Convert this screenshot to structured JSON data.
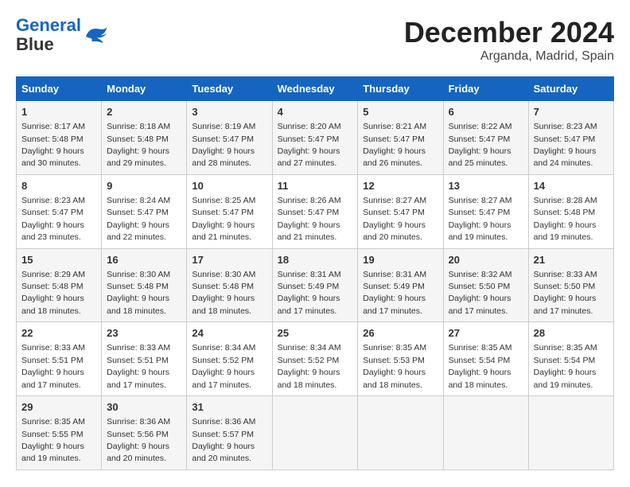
{
  "header": {
    "logo_line1": "General",
    "logo_line2": "Blue",
    "title": "December 2024",
    "subtitle": "Arganda, Madrid, Spain"
  },
  "calendar": {
    "headers": [
      "Sunday",
      "Monday",
      "Tuesday",
      "Wednesday",
      "Thursday",
      "Friday",
      "Saturday"
    ],
    "weeks": [
      [
        {
          "day": "1",
          "sunrise": "8:17 AM",
          "sunset": "5:48 PM",
          "daylight": "9 hours and 30 minutes."
        },
        {
          "day": "2",
          "sunrise": "8:18 AM",
          "sunset": "5:48 PM",
          "daylight": "9 hours and 29 minutes."
        },
        {
          "day": "3",
          "sunrise": "8:19 AM",
          "sunset": "5:47 PM",
          "daylight": "9 hours and 28 minutes."
        },
        {
          "day": "4",
          "sunrise": "8:20 AM",
          "sunset": "5:47 PM",
          "daylight": "9 hours and 27 minutes."
        },
        {
          "day": "5",
          "sunrise": "8:21 AM",
          "sunset": "5:47 PM",
          "daylight": "9 hours and 26 minutes."
        },
        {
          "day": "6",
          "sunrise": "8:22 AM",
          "sunset": "5:47 PM",
          "daylight": "9 hours and 25 minutes."
        },
        {
          "day": "7",
          "sunrise": "8:23 AM",
          "sunset": "5:47 PM",
          "daylight": "9 hours and 24 minutes."
        }
      ],
      [
        {
          "day": "8",
          "sunrise": "8:23 AM",
          "sunset": "5:47 PM",
          "daylight": "9 hours and 23 minutes."
        },
        {
          "day": "9",
          "sunrise": "8:24 AM",
          "sunset": "5:47 PM",
          "daylight": "9 hours and 22 minutes."
        },
        {
          "day": "10",
          "sunrise": "8:25 AM",
          "sunset": "5:47 PM",
          "daylight": "9 hours and 21 minutes."
        },
        {
          "day": "11",
          "sunrise": "8:26 AM",
          "sunset": "5:47 PM",
          "daylight": "9 hours and 21 minutes."
        },
        {
          "day": "12",
          "sunrise": "8:27 AM",
          "sunset": "5:47 PM",
          "daylight": "9 hours and 20 minutes."
        },
        {
          "day": "13",
          "sunrise": "8:27 AM",
          "sunset": "5:47 PM",
          "daylight": "9 hours and 19 minutes."
        },
        {
          "day": "14",
          "sunrise": "8:28 AM",
          "sunset": "5:48 PM",
          "daylight": "9 hours and 19 minutes."
        }
      ],
      [
        {
          "day": "15",
          "sunrise": "8:29 AM",
          "sunset": "5:48 PM",
          "daylight": "9 hours and 18 minutes."
        },
        {
          "day": "16",
          "sunrise": "8:30 AM",
          "sunset": "5:48 PM",
          "daylight": "9 hours and 18 minutes."
        },
        {
          "day": "17",
          "sunrise": "8:30 AM",
          "sunset": "5:48 PM",
          "daylight": "9 hours and 18 minutes."
        },
        {
          "day": "18",
          "sunrise": "8:31 AM",
          "sunset": "5:49 PM",
          "daylight": "9 hours and 17 minutes."
        },
        {
          "day": "19",
          "sunrise": "8:31 AM",
          "sunset": "5:49 PM",
          "daylight": "9 hours and 17 minutes."
        },
        {
          "day": "20",
          "sunrise": "8:32 AM",
          "sunset": "5:50 PM",
          "daylight": "9 hours and 17 minutes."
        },
        {
          "day": "21",
          "sunrise": "8:33 AM",
          "sunset": "5:50 PM",
          "daylight": "9 hours and 17 minutes."
        }
      ],
      [
        {
          "day": "22",
          "sunrise": "8:33 AM",
          "sunset": "5:51 PM",
          "daylight": "9 hours and 17 minutes."
        },
        {
          "day": "23",
          "sunrise": "8:33 AM",
          "sunset": "5:51 PM",
          "daylight": "9 hours and 17 minutes."
        },
        {
          "day": "24",
          "sunrise": "8:34 AM",
          "sunset": "5:52 PM",
          "daylight": "9 hours and 17 minutes."
        },
        {
          "day": "25",
          "sunrise": "8:34 AM",
          "sunset": "5:52 PM",
          "daylight": "9 hours and 18 minutes."
        },
        {
          "day": "26",
          "sunrise": "8:35 AM",
          "sunset": "5:53 PM",
          "daylight": "9 hours and 18 minutes."
        },
        {
          "day": "27",
          "sunrise": "8:35 AM",
          "sunset": "5:54 PM",
          "daylight": "9 hours and 18 minutes."
        },
        {
          "day": "28",
          "sunrise": "8:35 AM",
          "sunset": "5:54 PM",
          "daylight": "9 hours and 19 minutes."
        }
      ],
      [
        {
          "day": "29",
          "sunrise": "8:35 AM",
          "sunset": "5:55 PM",
          "daylight": "9 hours and 19 minutes."
        },
        {
          "day": "30",
          "sunrise": "8:36 AM",
          "sunset": "5:56 PM",
          "daylight": "9 hours and 20 minutes."
        },
        {
          "day": "31",
          "sunrise": "8:36 AM",
          "sunset": "5:57 PM",
          "daylight": "9 hours and 20 minutes."
        },
        null,
        null,
        null,
        null
      ]
    ]
  }
}
